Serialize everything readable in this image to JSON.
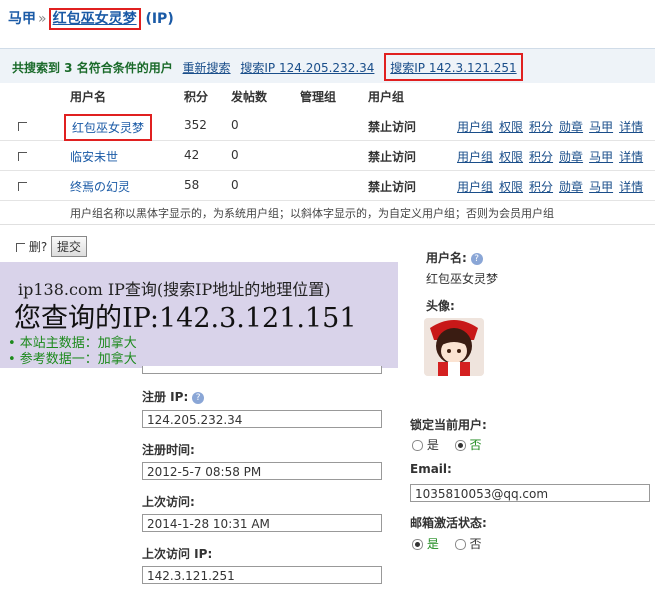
{
  "breadcrumb": {
    "root": "马甲",
    "sep": "»",
    "user": "红包巫女灵梦",
    "suffix": "(IP)"
  },
  "summary": {
    "text": "共搜索到 3 名符合条件的用户",
    "re_search": "重新搜索",
    "search_ip1": "搜索IP 124.205.232.34",
    "search_ip2": "搜索IP 142.3.121.251"
  },
  "table": {
    "headers": [
      "用户名",
      "积分",
      "发帖数",
      "管理组",
      "用户组"
    ],
    "rows": [
      {
        "name": "红包巫女灵梦",
        "points": "352",
        "posts": "0",
        "group": "禁止访问"
      },
      {
        "name": "临安未世",
        "points": "42",
        "posts": "0",
        "group": "禁止访问"
      },
      {
        "name": "终焉の幻灵",
        "points": "58",
        "posts": "0",
        "group": "禁止访问"
      }
    ],
    "ops": [
      "用户组",
      "权限",
      "积分",
      "勋章",
      "马甲",
      "详情"
    ]
  },
  "note": "用户组名称以黑体字显示的，为系统用户组；以斜体字显示的，为自定义用户组；否则为会员用户组",
  "actions": {
    "delete_label": "删?",
    "submit": "提交"
  },
  "ip_lookup": {
    "heading": "ip138.com IP查询(搜索IP地址的地理位置)",
    "result": "您查询的IP:142.3.121.151",
    "line1": "• 本站主数据：加拿大",
    "line2": "• 参考数据一：加拿大"
  },
  "profile": {
    "username_label": "用户名:",
    "username": "红包巫女灵梦",
    "avatar_label": "头像:",
    "reg_ip_label": "注册 IP:",
    "reg_ip": "124.205.232.34",
    "reg_time_label": "注册时间:",
    "reg_time": "2012-5-7 08:58 PM",
    "last_visit_label": "上次访问:",
    "last_visit": "2014-1-28 10:31 AM",
    "last_ip_label": "上次访问 IP:",
    "last_ip": "142.3.121.251",
    "lock_label": "锁定当前用户:",
    "lock_yes": "是",
    "lock_no": "否",
    "email_label": "Email:",
    "email": "1035810053@qq.com",
    "email_state_label": "邮箱激活状态:",
    "email_yes": "是",
    "email_no": "否"
  }
}
